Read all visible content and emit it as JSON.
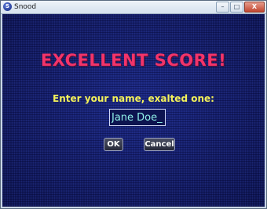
{
  "window": {
    "title": "Snood",
    "app_icon": "snood-app-icon",
    "controls": {
      "minimize": "–",
      "maximize": "□",
      "close": "X"
    }
  },
  "dialog": {
    "headline": "EXCELLENT SCORE!",
    "prompt": "Enter your name, exalted one:",
    "name_value": "Jane Doe_",
    "ok_label": "OK",
    "cancel_label": "Cancel"
  },
  "colors": {
    "headline": "#f2346a",
    "prompt": "#f4f25a",
    "input_text": "#8ff0e8",
    "background": "#121a55"
  }
}
